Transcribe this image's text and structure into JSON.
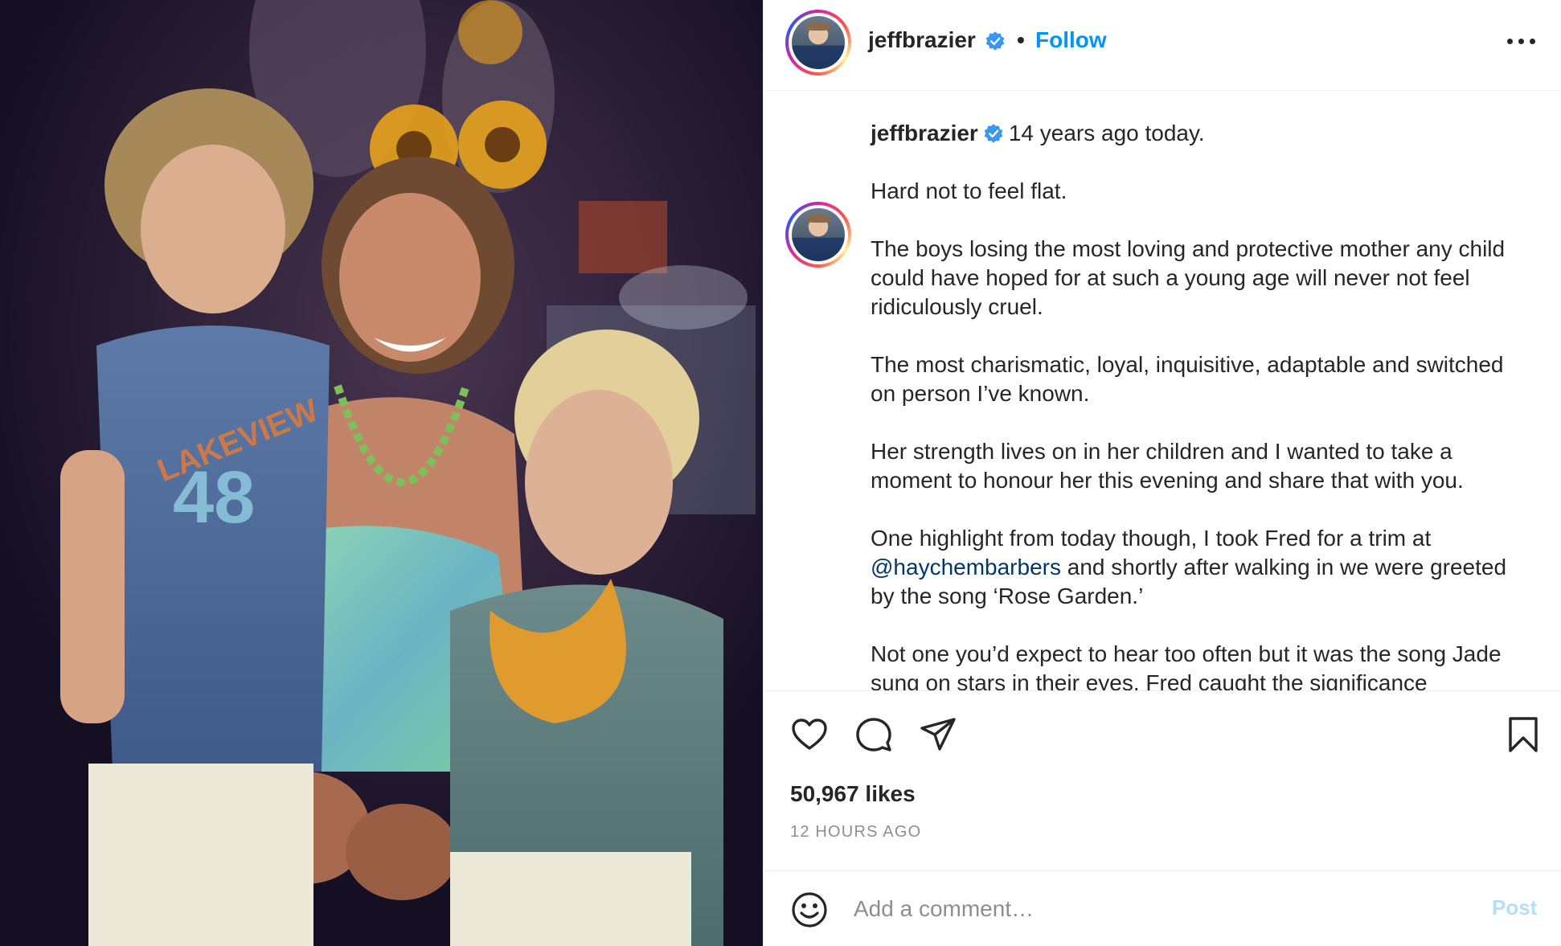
{
  "post": {
    "photo_alt": "Woman with two young boys",
    "author": {
      "username": "jeffbrazier",
      "verified": true
    },
    "header": {
      "separator": "•",
      "follow_label": "Follow",
      "more_icon": "more-horizontal-icon"
    },
    "caption": {
      "first_line": "14 years ago today.",
      "paragraphs": [
        "Hard not to feel flat.",
        "The boys losing the most loving and protective mother any child could have hoped for at such a young age will never not feel ridiculously cruel.",
        "The most charismatic, loyal, inquisitive, adaptable and switched on person I’ve known.",
        "Her strength lives on in her children and I wanted to take a moment to honour her this evening and share that with you."
      ],
      "highlight": {
        "before": "One highlight from today though, I took Fred for a trim at",
        "mention": "@haychembarbers",
        "after": "and shortly after walking in we were greeted by the song ‘Rose Garden.’"
      },
      "last_paragraph": "Not one you’d expect to hear too often but it was the song Jade sung on stars in their eyes. Fred caught the significance"
    },
    "actions": {
      "like_icon": "heart-icon",
      "comment_icon": "comment-icon",
      "share_icon": "paper-plane-icon",
      "save_icon": "bookmark-icon"
    },
    "likes": "50,967 likes",
    "timestamp": "12 HOURS AGO",
    "comment_box": {
      "emoji_icon": "smiley-icon",
      "placeholder": "Add a comment…",
      "post_label": "Post"
    },
    "colors": {
      "link_blue": "#0095f6",
      "mention_blue": "#00376b",
      "post_disabled": "#b2dffc",
      "verified_blue": "#3897f0"
    }
  }
}
